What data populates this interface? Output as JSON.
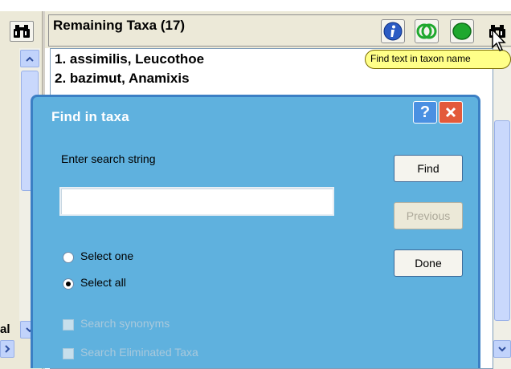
{
  "panel": {
    "title": "Remaining Taxa (17)",
    "taxa": [
      "1. assimilis, Leucothoe",
      "2. bazimut, Anamixis"
    ]
  },
  "tooltip": {
    "text": "Find text in taxon name"
  },
  "left_pane": {
    "partial_text": "al"
  },
  "dialog": {
    "title": "Find in taxa",
    "help_label": "?",
    "search_label": "Enter search string",
    "search_value": "",
    "select_one_label": "Select one",
    "select_all_label": "Select all",
    "selected_option": "Select all",
    "search_synonyms_label": "Search synonyms",
    "search_eliminated_label": "Search Eliminated Taxa",
    "find_button": "Find",
    "previous_button": "Previous",
    "done_button": "Done"
  },
  "colors": {
    "dialog_bg": "#5fb1de",
    "dialog_border": "#3b7fc4",
    "tooltip_bg": "#ffff88",
    "close_button": "#e35a3b",
    "info_icon": "#2b5bc4",
    "green_icon": "#1fa82e"
  },
  "icons": {
    "toolbar": [
      "binoculars-icon",
      "info-icon",
      "green-outline-circles-icon",
      "green-filled-circle-icon",
      "binoculars-icon"
    ],
    "cursor": "arrow-cursor-icon"
  }
}
